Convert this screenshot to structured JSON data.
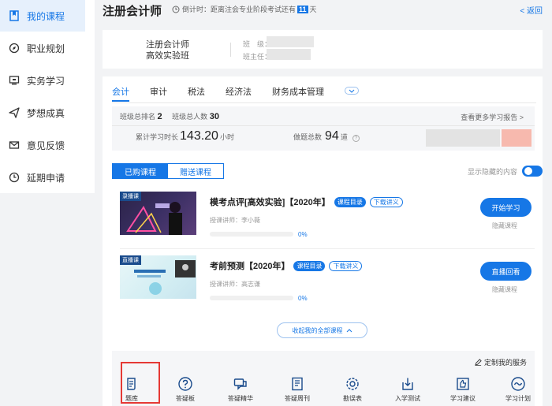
{
  "sidebar": {
    "items": [
      {
        "label": "我的课程",
        "icon": "bookmark-icon",
        "active": true
      },
      {
        "label": "职业规划",
        "icon": "compass-icon"
      },
      {
        "label": "实务学习",
        "icon": "monitor-icon"
      },
      {
        "label": "梦想成真",
        "icon": "paper-plane-icon"
      },
      {
        "label": "意见反馈",
        "icon": "mail-icon"
      },
      {
        "label": "延期申请",
        "icon": "clock-icon"
      }
    ]
  },
  "header": {
    "title": "注册会计师",
    "countdown_prefix": "倒计时：距离注会专业阶段考试还有",
    "days": "11",
    "days_suffix": "天",
    "back_label": "< 返回"
  },
  "class_info": {
    "name_line1": "注册会计师",
    "name_line2": "高效实验班",
    "class_label": "班　级：",
    "teacher_label": "班主任："
  },
  "subject_tabs": [
    "会计",
    "审计",
    "税法",
    "经济法",
    "财务成本管理"
  ],
  "stats": {
    "rank_label": "班级总排名",
    "rank_value": "2",
    "total_label": "班级总人数",
    "total_value": "30",
    "report_link": "查看更多学习报告 >",
    "study_time_label": "累计学习时长",
    "study_time_value": "143.20",
    "study_time_unit": "小时",
    "questions_label": "做题总数",
    "questions_value": "94",
    "questions_unit": "道",
    "help_glyph": "?"
  },
  "course_tabs": {
    "purchased": "已购课程",
    "gifted": "赠送课程",
    "show_hidden": "显示隐藏的内容"
  },
  "courses": [
    {
      "thumb_label": "录播课",
      "title": "模考点评[高效实验]【2020年】",
      "badge1": "课程目录",
      "badge2": "下载讲义",
      "teacher": "授课讲师：李小薇",
      "progress": 0,
      "progress_text": "0%",
      "action": "开始学习",
      "hide": "隐藏课程"
    },
    {
      "thumb_label": "直播课",
      "title": "考前预测【2020年】",
      "badge1": "课程目录",
      "badge2": "下载讲义",
      "teacher": "授课讲师：高志谦",
      "progress": 0,
      "progress_text": "0%",
      "action": "直播回看",
      "hide": "隐藏课程"
    }
  ],
  "collapse_label": "收起我的全部课程",
  "services": {
    "custom_label": "定制我的服务",
    "items": [
      {
        "label": "题库",
        "icon": "scroll-icon"
      },
      {
        "label": "答疑板",
        "icon": "question-bubble-icon"
      },
      {
        "label": "答疑精华",
        "icon": "chat-icon"
      },
      {
        "label": "答疑周刊",
        "icon": "book-icon"
      },
      {
        "label": "勘误表",
        "icon": "gear-icon"
      },
      {
        "label": "入学测试",
        "icon": "download-box-icon"
      },
      {
        "label": "学习建议",
        "icon": "thumbs-up-icon"
      },
      {
        "label": "学习计划",
        "icon": "wave-circle-icon"
      }
    ]
  },
  "colors": {
    "accent": "#1677e6",
    "highlight": "#e53935"
  }
}
